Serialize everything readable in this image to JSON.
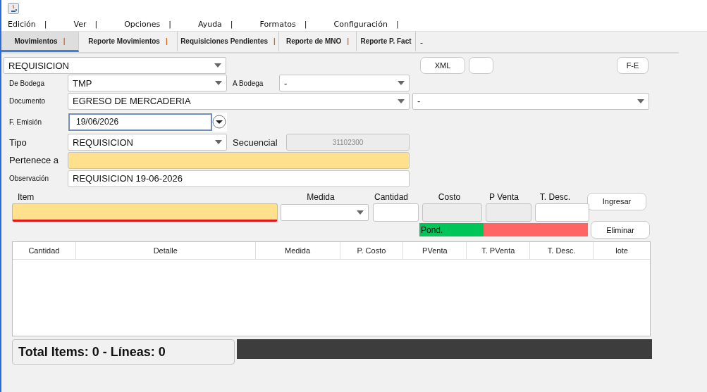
{
  "menu": [
    {
      "label": "Edición",
      "separator": "|"
    },
    {
      "label": "Ver",
      "separator": "|"
    },
    {
      "label": "Opciones",
      "separator": "|"
    },
    {
      "label": "Ayuda",
      "separator": "|"
    },
    {
      "label": "Formatos",
      "separator": "|"
    },
    {
      "label": "Configuración",
      "separator": "|"
    }
  ],
  "tabs": [
    {
      "label": "Movimientos",
      "separator": "|",
      "selected": true
    },
    {
      "label": "Reporte Movimientos",
      "separator": "|",
      "selected": false
    },
    {
      "label": "Requisiciones Pendientes",
      "separator": "|",
      "selected": false
    },
    {
      "label": "Reporte de MNO",
      "separator": "|",
      "selected": false
    },
    {
      "label": "Reporte P. Fact",
      "selected": false
    }
  ],
  "tabs_trailing": "-",
  "form": {
    "tipo_movimiento": "REQUISICION",
    "buttons": [
      "XML",
      "F-E"
    ],
    "de_bodega": {
      "label": "De Bodega",
      "value": "TMP"
    },
    "a_bodega": {
      "label": "A Bodega",
      "value": "-"
    },
    "documento": {
      "label": "Documento",
      "value": "EGRESO DE MERCADERIA",
      "extra": "-"
    },
    "emision": {
      "label": "F. Emisión",
      "value": "19/06/2026"
    },
    "tipo": {
      "label": "Tipo",
      "value": "REQUISICION"
    },
    "secuencial": {
      "label": "Secuencial",
      "value": "31102300",
      "disabled": true
    },
    "pertenece": {
      "label": "Pertenece a"
    },
    "observacion": {
      "label": "Observación",
      "value": "REQUISICION 19-06-2026"
    }
  },
  "item_entry": {
    "labels": [
      "Item",
      "Medida",
      "Cantidad",
      "Costo",
      "P Venta",
      "T. Desc."
    ],
    "buttons": [
      "Ingresar",
      "Eliminar"
    ],
    "pond": "Pond."
  },
  "table": {
    "columns": [
      "Cantidad",
      "Detalle",
      "Medida",
      "P. Costo",
      "PVenta",
      "T. PVenta",
      "T. Desc.",
      "lote"
    ]
  },
  "totals": "Total Items: 0 - Líneas: 0"
}
